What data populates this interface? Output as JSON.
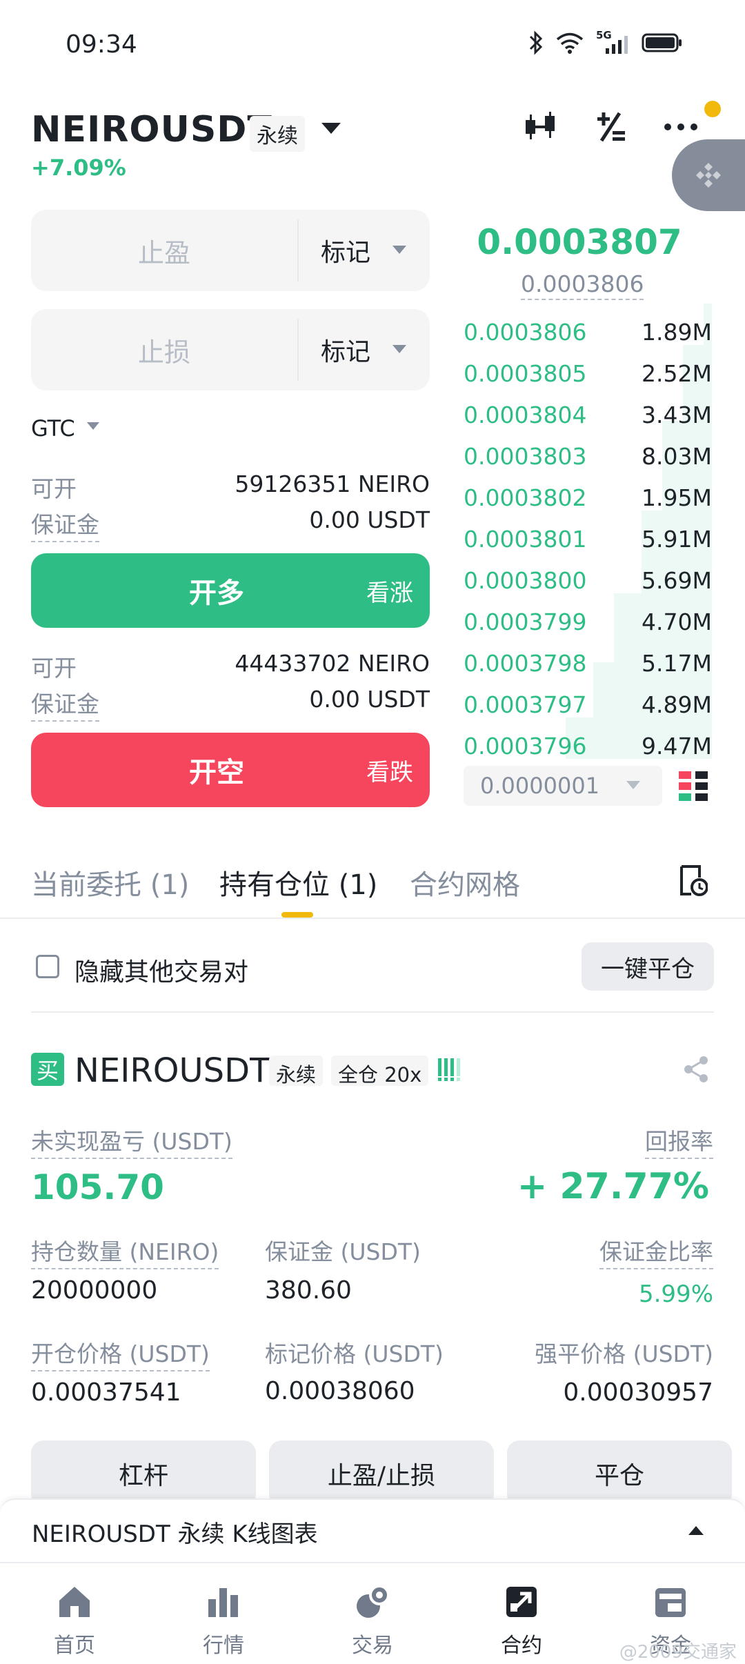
{
  "status_bar": {
    "time": "09:34",
    "network": "5G"
  },
  "header": {
    "symbol": "NEIROUSDT",
    "contract_type": "永续",
    "change": "+7.09%"
  },
  "form": {
    "take_profit": {
      "placeholder": "止盈",
      "trigger": "标记"
    },
    "stop_loss": {
      "placeholder": "止损",
      "trigger": "标记"
    },
    "time_in_force": "GTC",
    "long": {
      "available_label": "可开",
      "available_value": "59126351 NEIRO",
      "margin_label": "保证金",
      "margin_value": "0.00 USDT",
      "button": "开多",
      "button_hint": "看涨"
    },
    "short": {
      "available_label": "可开",
      "available_value": "44433702 NEIRO",
      "margin_label": "保证金",
      "margin_value": "0.00 USDT",
      "button": "开空",
      "button_hint": "看跌"
    }
  },
  "orderbook": {
    "last_price": "0.0003807",
    "mark_price": "0.0003806",
    "bids": [
      {
        "price": "0.0003806",
        "qty": "1.89M"
      },
      {
        "price": "0.0003805",
        "qty": "2.52M"
      },
      {
        "price": "0.0003804",
        "qty": "3.43M"
      },
      {
        "price": "0.0003803",
        "qty": "8.03M"
      },
      {
        "price": "0.0003802",
        "qty": "1.95M"
      },
      {
        "price": "0.0003801",
        "qty": "5.91M"
      },
      {
        "price": "0.0003800",
        "qty": "5.69M"
      },
      {
        "price": "0.0003799",
        "qty": "4.70M"
      },
      {
        "price": "0.0003798",
        "qty": "5.17M"
      },
      {
        "price": "0.0003797",
        "qty": "4.89M"
      },
      {
        "price": "0.0003796",
        "qty": "9.47M"
      }
    ],
    "tick_size": "0.0000001"
  },
  "tabs": [
    {
      "label": "当前委托 (1)",
      "active": false
    },
    {
      "label": "持有仓位 (1)",
      "active": true
    },
    {
      "label": "合约网格",
      "active": false
    }
  ],
  "positions_toolbar": {
    "hide_others": "隐藏其他交易对",
    "close_all": "一键平仓"
  },
  "position": {
    "side": "买",
    "symbol": "NEIROUSDT",
    "contract_type": "永续",
    "margin_mode": "全仓 20x",
    "unrealized_pnl_label": "未实现盈亏 (USDT)",
    "unrealized_pnl": "105.70",
    "roe_label": "回报率",
    "roe": "+ 27.77%",
    "size_label": "持仓数量 (NEIRO)",
    "size": "20000000",
    "margin_label": "保证金 (USDT)",
    "margin": "380.60",
    "margin_ratio_label": "保证金比率",
    "margin_ratio": "5.99%",
    "entry_price_label": "开仓价格 (USDT)",
    "entry_price": "0.00037541",
    "mark_price_label": "标记价格 (USDT)",
    "mark_price": "0.00038060",
    "liq_price_label": "强平价格 (USDT)",
    "liq_price": "0.00030957",
    "actions": [
      "杠杆",
      "止盈/止损",
      "平仓"
    ]
  },
  "chart_bar": {
    "label": "NEIROUSDT 永续 K线图表"
  },
  "nav": [
    {
      "label": "首页",
      "icon": "home-icon"
    },
    {
      "label": "行情",
      "icon": "markets-icon"
    },
    {
      "label": "交易",
      "icon": "trade-icon"
    },
    {
      "label": "合约",
      "icon": "futures-icon",
      "active": true
    },
    {
      "label": "资金",
      "icon": "wallet-icon"
    }
  ],
  "watermark": "@2009交通家"
}
